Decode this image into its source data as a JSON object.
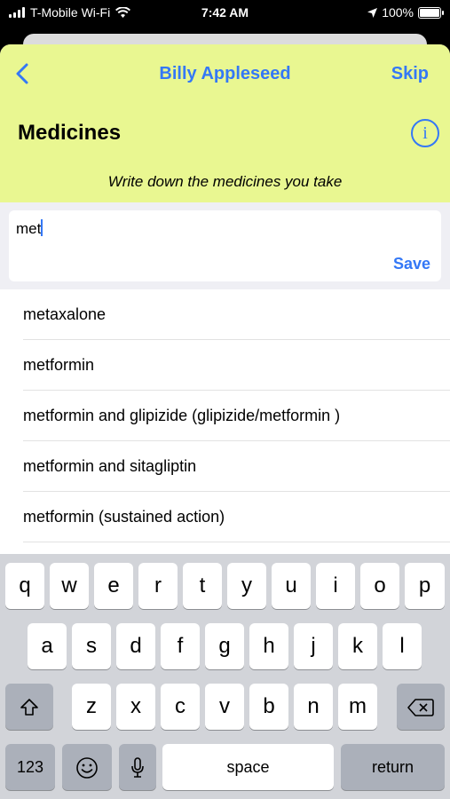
{
  "status_bar": {
    "carrier": "T-Mobile Wi-Fi",
    "time": "7:42 AM",
    "battery": "100%"
  },
  "nav": {
    "title": "Billy Appleseed",
    "skip": "Skip"
  },
  "section": {
    "title": "Medicines",
    "instruction": "Write down the medicines you take"
  },
  "input": {
    "value": "met",
    "save_label": "Save"
  },
  "suggestions": [
    "metaxalone",
    "metformin",
    "metformin and glipizide (glipizide/metformin )",
    "metformin and sitagliptin",
    "metformin (sustained action)"
  ],
  "keyboard": {
    "row1": [
      "q",
      "w",
      "e",
      "r",
      "t",
      "y",
      "u",
      "i",
      "o",
      "p"
    ],
    "row2": [
      "a",
      "s",
      "d",
      "f",
      "g",
      "h",
      "j",
      "k",
      "l"
    ],
    "row3": [
      "z",
      "x",
      "c",
      "v",
      "b",
      "n",
      "m"
    ],
    "numbers_label": "123",
    "space_label": "space",
    "return_label": "return"
  },
  "colors": {
    "header_bg": "#e9f791",
    "accent": "#3478f6"
  },
  "icons": {
    "wifi": "wifi-icon",
    "location": "location-arrow-icon",
    "battery": "battery-icon",
    "back": "chevron-left-icon",
    "info": "info-icon",
    "shift": "shift-icon",
    "emoji": "emoji-icon",
    "mic": "microphone-icon",
    "delete": "delete-icon"
  }
}
